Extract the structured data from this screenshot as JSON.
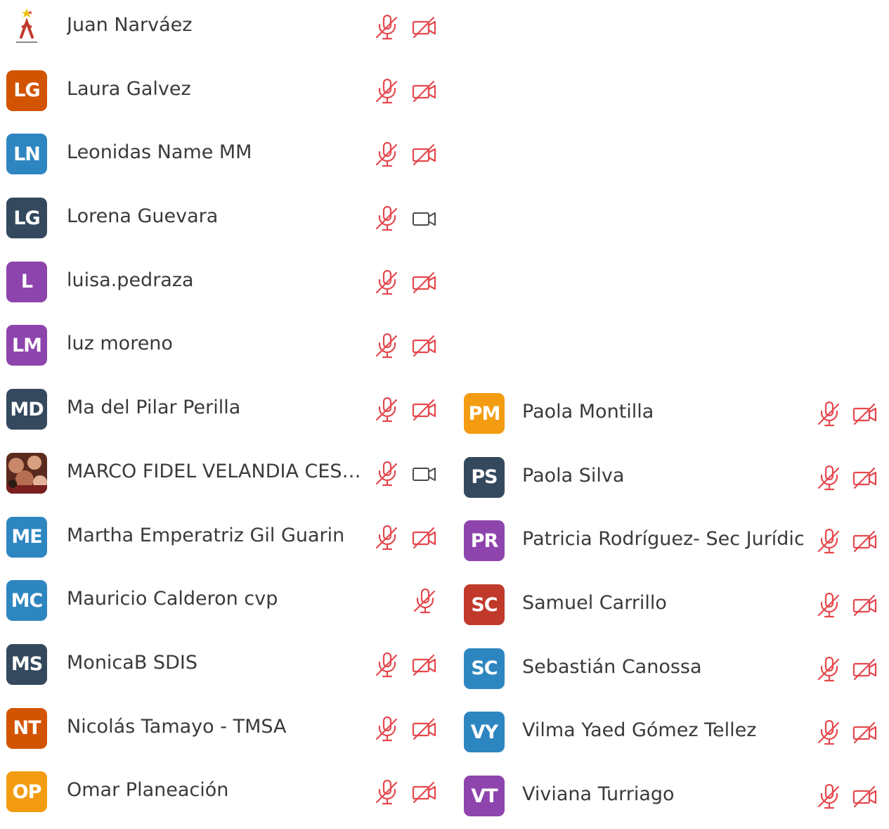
{
  "colors": {
    "muted_red": "#e5484d",
    "text": "#3a3a3a",
    "gray_icon": "#4a4a4a"
  },
  "participants_left": [
    {
      "initials": "",
      "name": "Juan Narváez",
      "avatar_color": "",
      "avatar_type": "logo",
      "mic": "mic-muted-icon",
      "cam": "video-off-icon"
    },
    {
      "initials": "LG",
      "name": "Laura Galvez",
      "avatar_color": "#d35400",
      "mic": "mic-muted-icon",
      "cam": "video-off-icon"
    },
    {
      "initials": "LN",
      "name": "Leonidas Name MM",
      "avatar_color": "#2e86c1",
      "mic": "mic-muted-icon",
      "cam": "video-off-icon"
    },
    {
      "initials": "LG",
      "name": "Lorena Guevara",
      "avatar_color": "#34495e",
      "mic": "mic-muted-icon",
      "cam": "video-on-icon"
    },
    {
      "initials": "L",
      "name": "luisa.pedraza",
      "avatar_color": "#8e44ad",
      "mic": "mic-muted-icon",
      "cam": "video-off-icon"
    },
    {
      "initials": "LM",
      "name": "luz moreno",
      "avatar_color": "#8e44ad",
      "mic": "mic-muted-icon",
      "cam": "video-off-icon"
    },
    {
      "initials": "MD",
      "name": "Ma del Pilar Perilla",
      "avatar_color": "#34495e",
      "mic": "mic-muted-icon",
      "cam": "video-off-icon"
    },
    {
      "initials": "",
      "name": "MARCO FIDEL VELANDIA CESPE...",
      "avatar_color": "",
      "avatar_type": "photo",
      "mic": "mic-muted-icon",
      "cam": "video-on-icon"
    },
    {
      "initials": "ME",
      "name": "Martha Emperatriz Gil Guarin",
      "avatar_color": "#2e86c1",
      "mic": "mic-muted-icon",
      "cam": "video-off-icon"
    },
    {
      "initials": "MC",
      "name": "Mauricio Calderon cvp",
      "avatar_color": "#2e86c1",
      "mic": "",
      "cam": "mic-muted-icon"
    },
    {
      "initials": "MS",
      "name": "MonicaB SDIS",
      "avatar_color": "#34495e",
      "mic": "mic-muted-icon",
      "cam": "video-off-icon"
    },
    {
      "initials": "NT",
      "name": "Nicolás Tamayo  - TMSA",
      "avatar_color": "#d35400",
      "mic": "mic-muted-icon",
      "cam": "video-off-icon"
    },
    {
      "initials": "OP",
      "name": "Omar Planeación",
      "avatar_color": "#f39c12",
      "mic": "mic-muted-icon",
      "cam": "video-off-icon"
    }
  ],
  "participants_right": [
    {
      "initials": "PM",
      "name": "Paola Montilla",
      "avatar_color": "#f39c12",
      "mic": "mic-muted-icon",
      "cam": "video-off-icon"
    },
    {
      "initials": "PS",
      "name": "Paola Silva",
      "avatar_color": "#34495e",
      "mic": "mic-muted-icon",
      "cam": "video-off-icon"
    },
    {
      "initials": "PR",
      "name": "Patricia Rodríguez- Sec Jurídica",
      "avatar_color": "#8e44ad",
      "mic": "mic-muted-icon",
      "cam": "video-off-icon"
    },
    {
      "initials": "SC",
      "name": "Samuel Carrillo",
      "avatar_color": "#c0392b",
      "mic": "mic-muted-icon",
      "cam": "video-off-icon"
    },
    {
      "initials": "SC",
      "name": "Sebastián Canossa",
      "avatar_color": "#2e86c1",
      "mic": "mic-muted-icon",
      "cam": "video-off-icon"
    },
    {
      "initials": "VY",
      "name": "Vilma Yaed Gómez Tellez",
      "avatar_color": "#2e86c1",
      "mic": "mic-muted-icon",
      "cam": "video-off-icon"
    },
    {
      "initials": "VT",
      "name": "Viviana Turriago",
      "avatar_color": "#8e44ad",
      "mic": "mic-muted-icon",
      "cam": "video-off-icon"
    }
  ]
}
